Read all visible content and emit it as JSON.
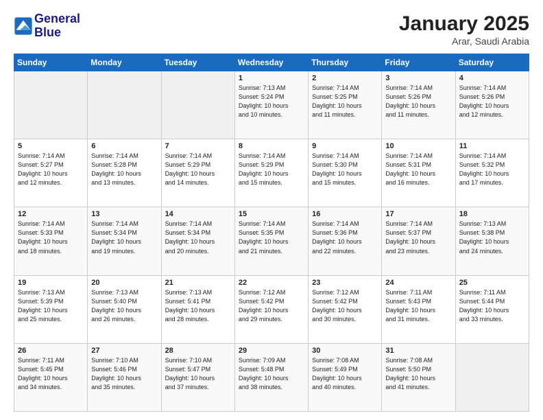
{
  "header": {
    "logo_line1": "General",
    "logo_line2": "Blue",
    "title": "January 2025",
    "subtitle": "Arar, Saudi Arabia"
  },
  "days_of_week": [
    "Sunday",
    "Monday",
    "Tuesday",
    "Wednesday",
    "Thursday",
    "Friday",
    "Saturday"
  ],
  "weeks": [
    [
      {
        "day": "",
        "info": ""
      },
      {
        "day": "",
        "info": ""
      },
      {
        "day": "",
        "info": ""
      },
      {
        "day": "1",
        "info": "Sunrise: 7:13 AM\nSunset: 5:24 PM\nDaylight: 10 hours\nand 10 minutes."
      },
      {
        "day": "2",
        "info": "Sunrise: 7:14 AM\nSunset: 5:25 PM\nDaylight: 10 hours\nand 11 minutes."
      },
      {
        "day": "3",
        "info": "Sunrise: 7:14 AM\nSunset: 5:26 PM\nDaylight: 10 hours\nand 11 minutes."
      },
      {
        "day": "4",
        "info": "Sunrise: 7:14 AM\nSunset: 5:26 PM\nDaylight: 10 hours\nand 12 minutes."
      }
    ],
    [
      {
        "day": "5",
        "info": "Sunrise: 7:14 AM\nSunset: 5:27 PM\nDaylight: 10 hours\nand 12 minutes."
      },
      {
        "day": "6",
        "info": "Sunrise: 7:14 AM\nSunset: 5:28 PM\nDaylight: 10 hours\nand 13 minutes."
      },
      {
        "day": "7",
        "info": "Sunrise: 7:14 AM\nSunset: 5:29 PM\nDaylight: 10 hours\nand 14 minutes."
      },
      {
        "day": "8",
        "info": "Sunrise: 7:14 AM\nSunset: 5:29 PM\nDaylight: 10 hours\nand 15 minutes."
      },
      {
        "day": "9",
        "info": "Sunrise: 7:14 AM\nSunset: 5:30 PM\nDaylight: 10 hours\nand 15 minutes."
      },
      {
        "day": "10",
        "info": "Sunrise: 7:14 AM\nSunset: 5:31 PM\nDaylight: 10 hours\nand 16 minutes."
      },
      {
        "day": "11",
        "info": "Sunrise: 7:14 AM\nSunset: 5:32 PM\nDaylight: 10 hours\nand 17 minutes."
      }
    ],
    [
      {
        "day": "12",
        "info": "Sunrise: 7:14 AM\nSunset: 5:33 PM\nDaylight: 10 hours\nand 18 minutes."
      },
      {
        "day": "13",
        "info": "Sunrise: 7:14 AM\nSunset: 5:34 PM\nDaylight: 10 hours\nand 19 minutes."
      },
      {
        "day": "14",
        "info": "Sunrise: 7:14 AM\nSunset: 5:34 PM\nDaylight: 10 hours\nand 20 minutes."
      },
      {
        "day": "15",
        "info": "Sunrise: 7:14 AM\nSunset: 5:35 PM\nDaylight: 10 hours\nand 21 minutes."
      },
      {
        "day": "16",
        "info": "Sunrise: 7:14 AM\nSunset: 5:36 PM\nDaylight: 10 hours\nand 22 minutes."
      },
      {
        "day": "17",
        "info": "Sunrise: 7:14 AM\nSunset: 5:37 PM\nDaylight: 10 hours\nand 23 minutes."
      },
      {
        "day": "18",
        "info": "Sunrise: 7:13 AM\nSunset: 5:38 PM\nDaylight: 10 hours\nand 24 minutes."
      }
    ],
    [
      {
        "day": "19",
        "info": "Sunrise: 7:13 AM\nSunset: 5:39 PM\nDaylight: 10 hours\nand 25 minutes."
      },
      {
        "day": "20",
        "info": "Sunrise: 7:13 AM\nSunset: 5:40 PM\nDaylight: 10 hours\nand 26 minutes."
      },
      {
        "day": "21",
        "info": "Sunrise: 7:13 AM\nSunset: 5:41 PM\nDaylight: 10 hours\nand 28 minutes."
      },
      {
        "day": "22",
        "info": "Sunrise: 7:12 AM\nSunset: 5:42 PM\nDaylight: 10 hours\nand 29 minutes."
      },
      {
        "day": "23",
        "info": "Sunrise: 7:12 AM\nSunset: 5:42 PM\nDaylight: 10 hours\nand 30 minutes."
      },
      {
        "day": "24",
        "info": "Sunrise: 7:11 AM\nSunset: 5:43 PM\nDaylight: 10 hours\nand 31 minutes."
      },
      {
        "day": "25",
        "info": "Sunrise: 7:11 AM\nSunset: 5:44 PM\nDaylight: 10 hours\nand 33 minutes."
      }
    ],
    [
      {
        "day": "26",
        "info": "Sunrise: 7:11 AM\nSunset: 5:45 PM\nDaylight: 10 hours\nand 34 minutes."
      },
      {
        "day": "27",
        "info": "Sunrise: 7:10 AM\nSunset: 5:46 PM\nDaylight: 10 hours\nand 35 minutes."
      },
      {
        "day": "28",
        "info": "Sunrise: 7:10 AM\nSunset: 5:47 PM\nDaylight: 10 hours\nand 37 minutes."
      },
      {
        "day": "29",
        "info": "Sunrise: 7:09 AM\nSunset: 5:48 PM\nDaylight: 10 hours\nand 38 minutes."
      },
      {
        "day": "30",
        "info": "Sunrise: 7:08 AM\nSunset: 5:49 PM\nDaylight: 10 hours\nand 40 minutes."
      },
      {
        "day": "31",
        "info": "Sunrise: 7:08 AM\nSunset: 5:50 PM\nDaylight: 10 hours\nand 41 minutes."
      },
      {
        "day": "",
        "info": ""
      }
    ]
  ]
}
